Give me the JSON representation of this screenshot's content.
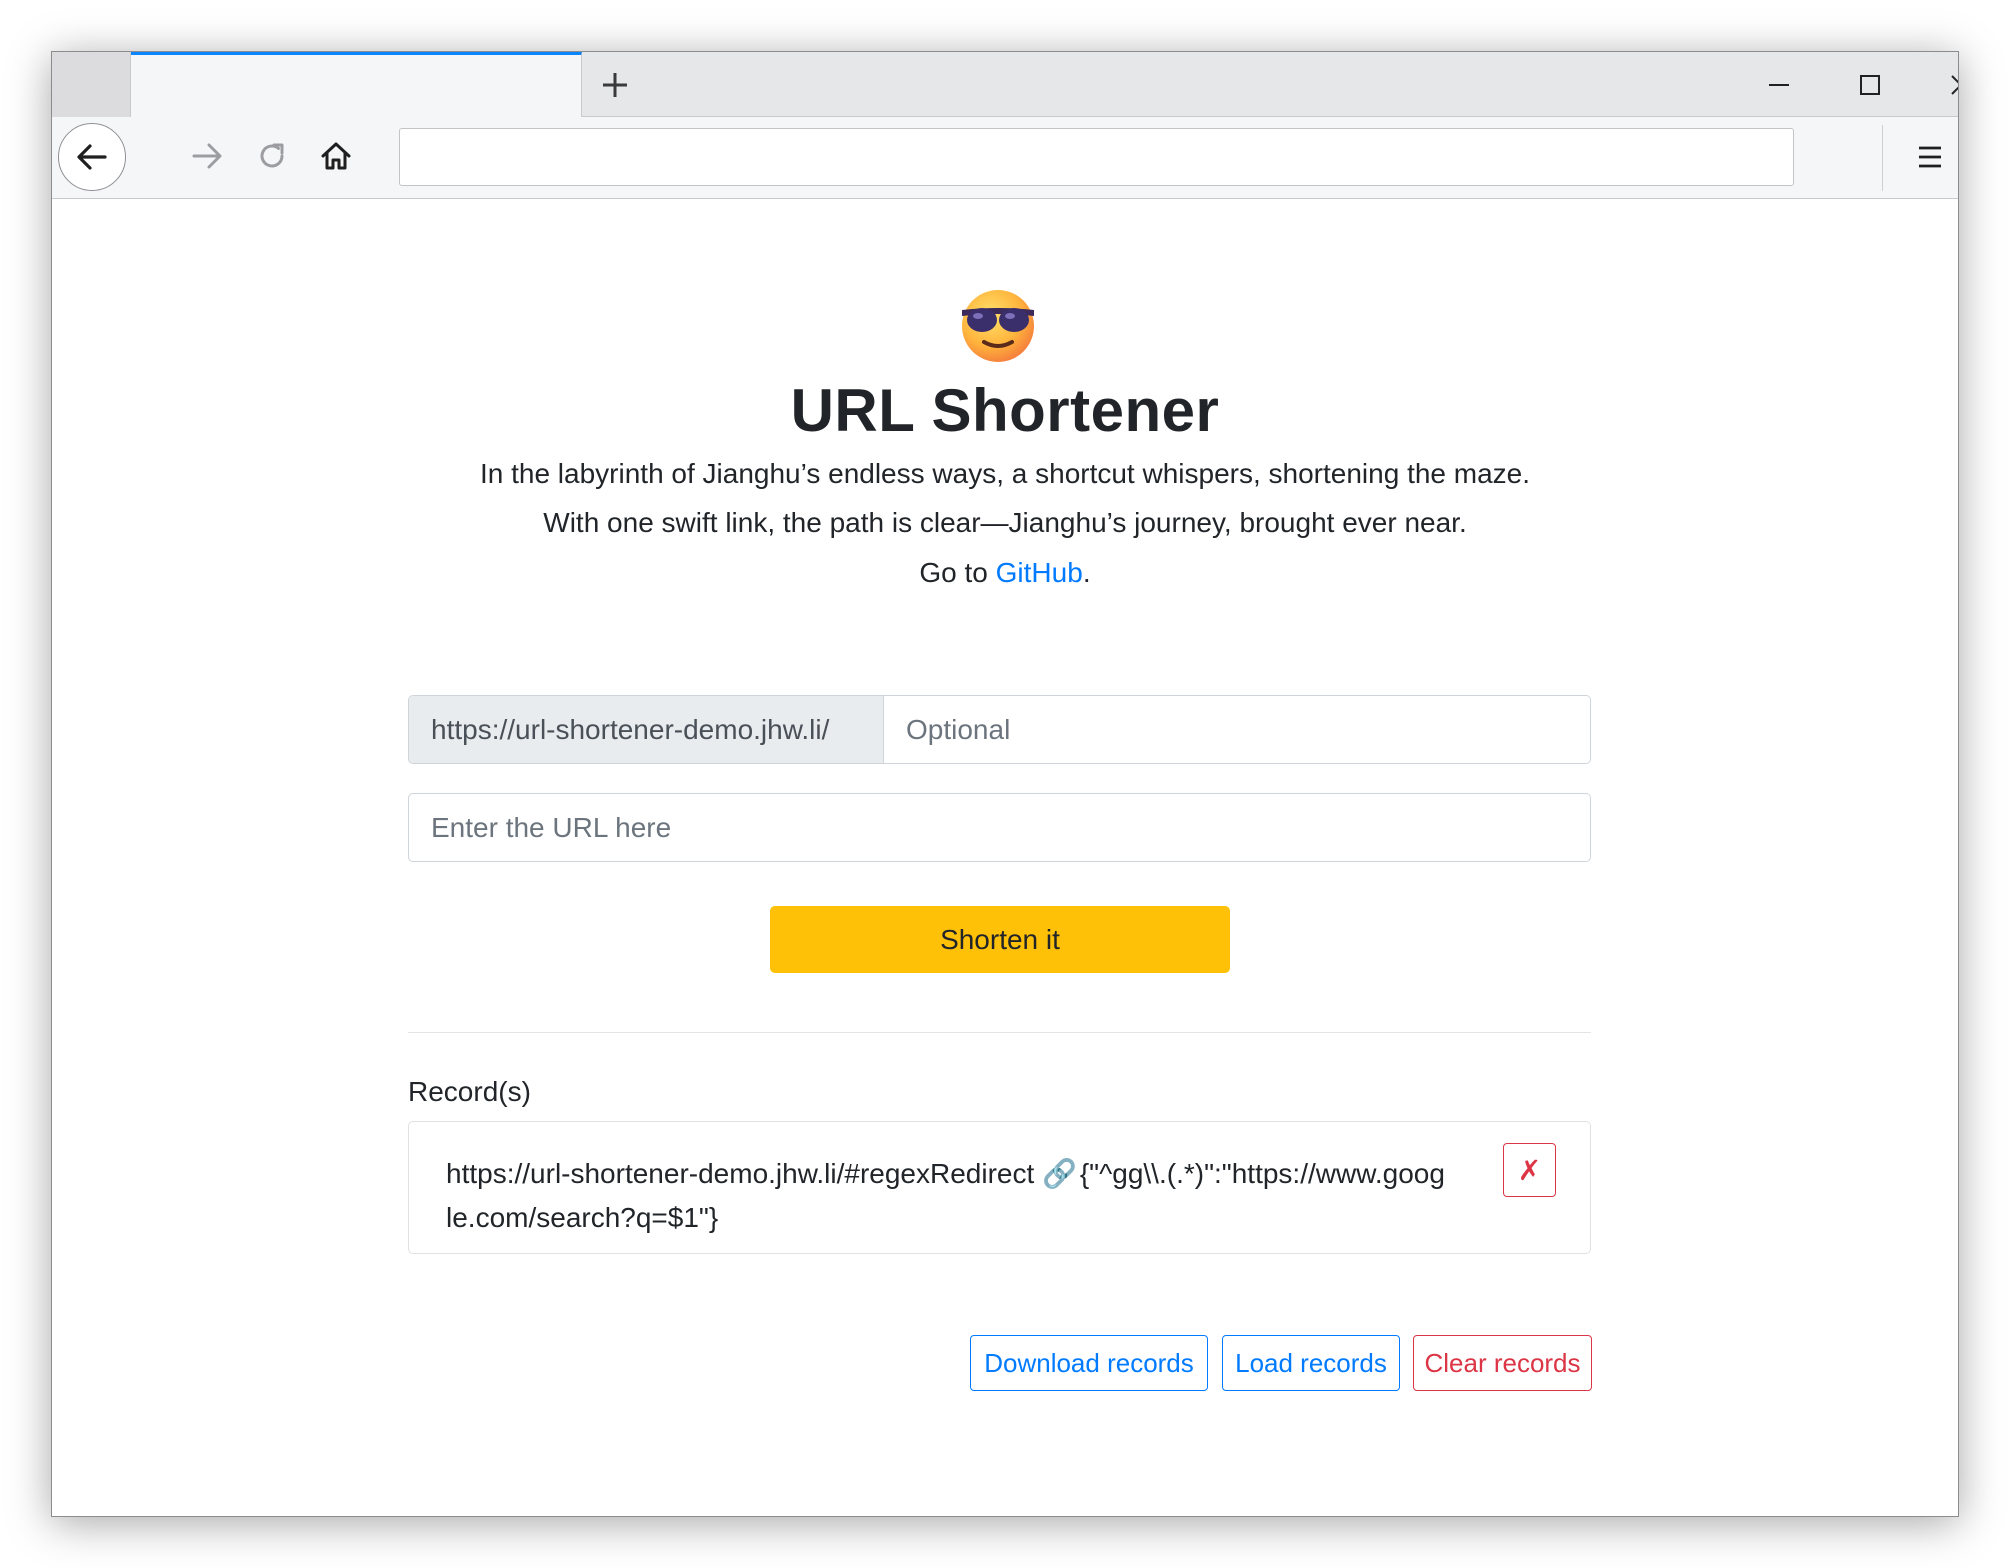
{
  "browser": {
    "url": "",
    "new_tab_icon": "plus-icon",
    "icons": [
      "back-arrow-icon",
      "forward-arrow-icon",
      "reload-icon",
      "home-icon",
      "hamburger-menu-icon",
      "minimize-icon",
      "maximize-icon",
      "close-icon"
    ]
  },
  "page": {
    "emoji": "😎",
    "title": "URL Shortener",
    "subtitle_line1": "In the labyrinth of Jianghu’s endless ways, a shortcut whispers, shortening the maze.",
    "subtitle_line2": "With one swift link, the path is clear—Jianghu’s journey, brought ever near.",
    "goto_prefix": "Go to ",
    "github_link": "GitHub",
    "goto_suffix": "."
  },
  "form": {
    "prefix": "https://url-shortener-demo.jhw.li/",
    "key_placeholder": "Optional",
    "url_placeholder": "Enter the URL here",
    "submit_label": "Shorten it"
  },
  "records": {
    "label": "Record(s)",
    "items": [
      {
        "short_url": "https://url-shortener-demo.jhw.li/#regexRedirect",
        "link_icon": "🔗",
        "target": "{\"^gg\\\\.(.*)\":\"https://www.google.com/search?q=$1\"}",
        "delete_label": "✗"
      }
    ],
    "download_label": "Download records",
    "load_label": "Load records",
    "clear_label": "Clear records"
  },
  "colors": {
    "accent": "#ffc107",
    "link": "#007bff",
    "danger": "#dc3545",
    "tab_highlight": "#0a84ff"
  }
}
